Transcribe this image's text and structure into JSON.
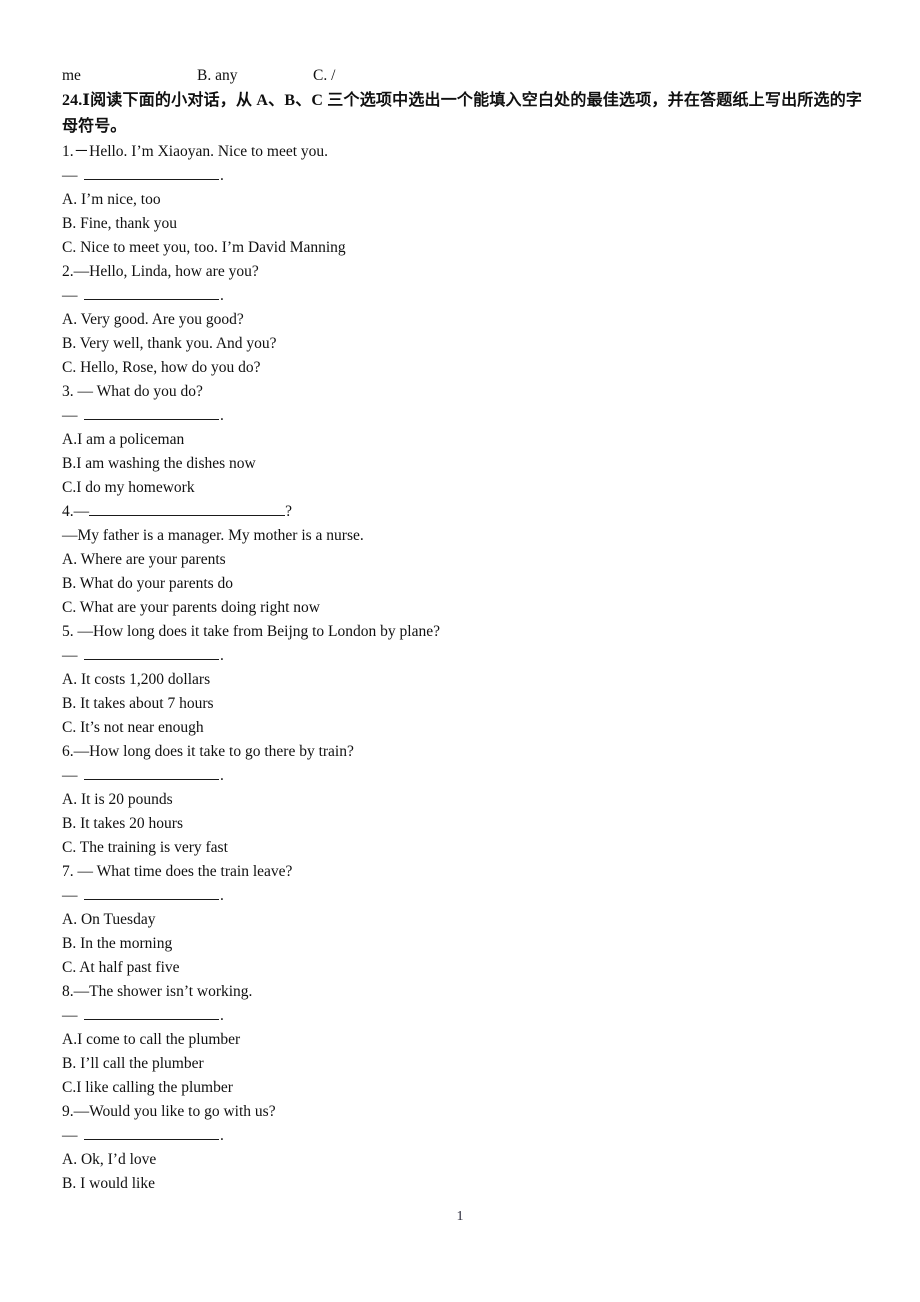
{
  "header_fragment": {
    "col1": "me",
    "col2": "B. any",
    "col3": "C. /"
  },
  "instruction": "24.Ⅰ阅读下面的小对话，从 A、B、C 三个选项中选出一个能填入空白处的最佳选项，并在答题纸上写出所选的字母符号。",
  "answer_blank": {
    "dash": "—",
    "terminator": "."
  },
  "questions": [
    {
      "prompt": "1.－Hello. I’m Xiaoyan. Nice to meet you.",
      "blank_style": "below",
      "options": [
        "A. I’m nice, too",
        "B. Fine, thank you",
        "C. Nice to meet you, too. I’m David Manning"
      ]
    },
    {
      "prompt": "2.—Hello, Linda, how are you?",
      "blank_style": "below",
      "options": [
        "A. Very good. Are you good?",
        "B. Very well, thank you. And you?",
        "C. Hello, Rose, how do you do?"
      ]
    },
    {
      "prompt": "3. — What do you do?",
      "blank_style": "below",
      "options": [
        "A.I am a policeman",
        "B.I am washing the dishes now",
        "C.I do my homework"
      ]
    },
    {
      "prompt_prefix": "4.—",
      "prompt_suffix": "?",
      "blank_style": "inline",
      "answer_text": "—My father is a manager. My mother is a nurse.",
      "options": [
        "A. Where are your parents",
        "B. What do your parents do",
        "C. What are your parents doing right now"
      ]
    },
    {
      "prompt": "5. —How long does it take from Beijng to London by plane?",
      "blank_style": "below",
      "options": [
        "A. It costs 1,200 dollars",
        "B. It takes about 7 hours",
        "C. It’s not near enough"
      ]
    },
    {
      "prompt": "6.—How long does it take to go there by train?",
      "blank_style": "below",
      "options": [
        "A. It is 20 pounds",
        "B. It takes 20 hours",
        "C. The training is very fast"
      ]
    },
    {
      "prompt": "7. — What time does the train leave?",
      "blank_style": "below",
      "options": [
        "A. On Tuesday",
        "B. In the morning",
        "C. At half past five"
      ]
    },
    {
      "prompt": "8.—The shower isn’t working.",
      "blank_style": "below",
      "options": [
        "A.I come to call the plumber",
        "B. I’ll call the plumber",
        "C.I like calling the plumber"
      ]
    },
    {
      "prompt": "9.—Would you like to go with us?",
      "blank_style": "below",
      "options": [
        "A. Ok, I’d love",
        "B. I would like"
      ]
    }
  ],
  "page_number": "1"
}
